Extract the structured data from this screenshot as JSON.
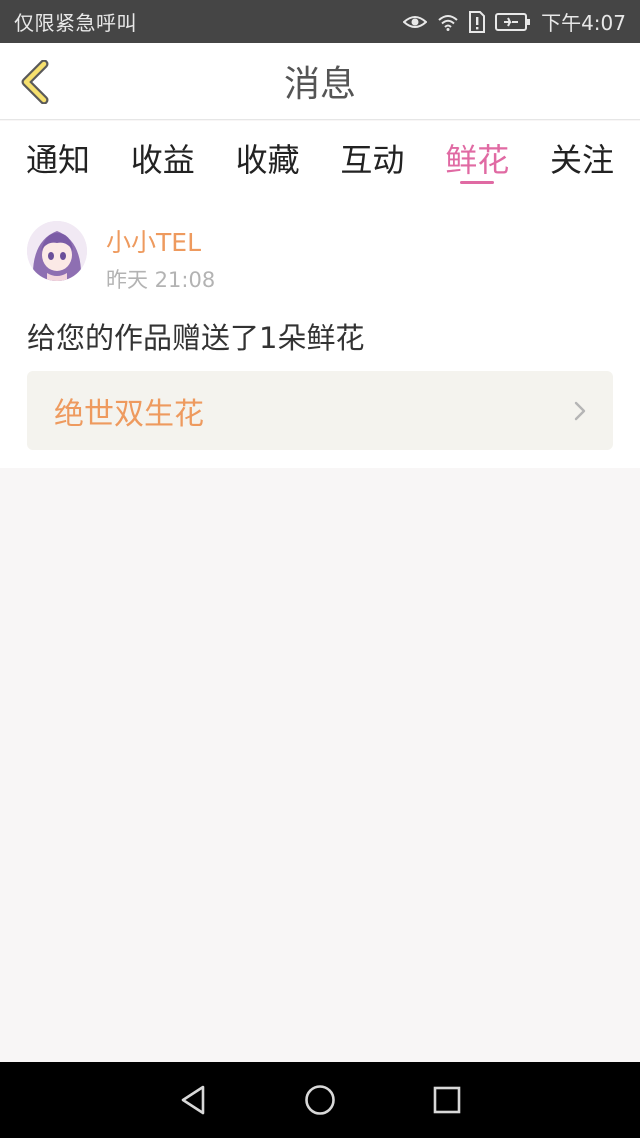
{
  "status_bar": {
    "left_text": "仅限紧急呼叫",
    "time": "下午4:07",
    "icons": [
      "eye-icon",
      "wifi-icon",
      "sim-alert-icon",
      "battery-charging-icon"
    ]
  },
  "header": {
    "title": "消息",
    "back_icon": "chevron-left-icon"
  },
  "tabs": [
    {
      "label": "通知",
      "active": false
    },
    {
      "label": "收益",
      "active": false
    },
    {
      "label": "收藏",
      "active": false
    },
    {
      "label": "互动",
      "active": false
    },
    {
      "label": "鲜花",
      "active": true
    },
    {
      "label": "关注",
      "active": false
    }
  ],
  "message": {
    "username": "小小TEL",
    "timestamp": "昨天 21:08",
    "text": "给您的作品赠送了1朵鲜花",
    "work_title": "绝世双生花",
    "arrow_icon": "chevron-right-icon"
  },
  "nav_bar": {
    "icons": [
      "back-triangle-icon",
      "home-circle-icon",
      "recents-square-icon"
    ]
  },
  "colors": {
    "accent_pink": "#e06aa3",
    "username_orange": "#ee9a5e",
    "status_bar_bg": "#454545",
    "page_bg": "#f8f6f6"
  }
}
